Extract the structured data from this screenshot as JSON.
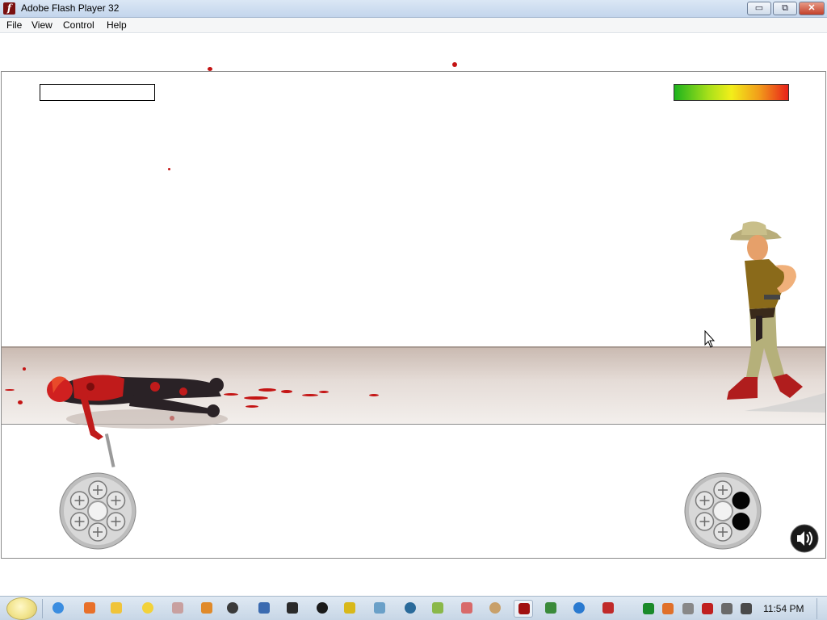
{
  "window": {
    "title": "Adobe Flash Player 32"
  },
  "window_controls": {
    "minimize": "▭",
    "maximize": "⧉",
    "close": "✕"
  },
  "menu": {
    "items": [
      "File",
      "View",
      "Control",
      "Help"
    ]
  },
  "game": {
    "player_health_fraction": 0.0,
    "enemy_health_fraction": 1.0,
    "player_chambers_loaded": 6,
    "enemy_chambers_loaded": 4,
    "chambers_total": 6,
    "sound": "on"
  },
  "icons": {
    "app": "flash-player-icon",
    "sound": "speaker-icon",
    "cylinder": "revolver-cylinder-icon"
  },
  "colors": {
    "blood": "#c41414",
    "health_high": "#1db31d",
    "health_low": "#e8211a",
    "ground": "#e5dcd7"
  },
  "taskbar": {
    "icons": [
      "chrome-icon",
      "firefox-icon",
      "folder-icon",
      "messenger-icon",
      "media-icon",
      "search-icon",
      "archive-7z-icon",
      "user-icon",
      "equalizer-icon",
      "terminal-icon",
      "shield-icon",
      "window-icon",
      "globe-icon",
      "notepad-icon",
      "gauge-icon",
      "paint-icon",
      "flash-player-icon",
      "monitor-icon",
      "edge-icon",
      "game-icon"
    ],
    "clock": "11:54 PM"
  }
}
